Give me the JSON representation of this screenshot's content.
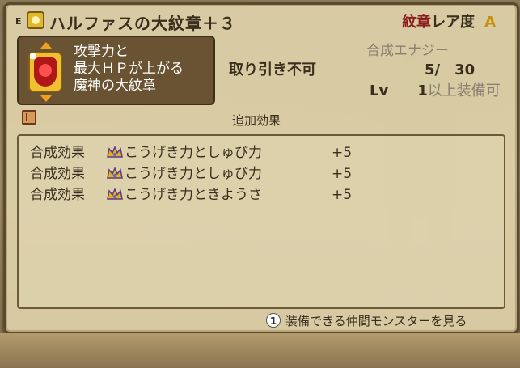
{
  "title": {
    "equip_mark": "E",
    "item_name": "ハルファスの大紋章＋３",
    "category": "紋章",
    "rarity_label": "レア度",
    "rarity_grade": "A"
  },
  "item": {
    "description_lines": [
      "攻撃力と",
      "最大ＨＰが上がる",
      "魔神の大紋章"
    ]
  },
  "status": {
    "trade": "取り引き不可",
    "synth_energy_label": "合成エナジー",
    "synth_energy_value": "5/　30",
    "level_label": "Lv",
    "level_value": "1",
    "level_req": "以上装備可"
  },
  "effects": {
    "header": "追加効果",
    "rows": [
      {
        "label": "合成効果",
        "stat": "こうげき力としゅび力",
        "value": "+5"
      },
      {
        "label": "合成効果",
        "stat": "こうげき力としゅび力",
        "value": "+5"
      },
      {
        "label": "合成効果",
        "stat": "こうげき力ときようさ",
        "value": "+5"
      }
    ]
  },
  "footer": {
    "button_key": "1",
    "action": "装備できる仲間モンスターを見る"
  },
  "colors": {
    "panel": "#ded0a8",
    "border": "#5b4a2e",
    "rarity_grade": "#c8900c",
    "item_box": "#6a5333"
  },
  "icons": {
    "title": "crest-badge-icon",
    "item": "red-demon-crest-icon",
    "book": "book-icon",
    "effect": "crown-icon",
    "button": "button-1-icon"
  }
}
